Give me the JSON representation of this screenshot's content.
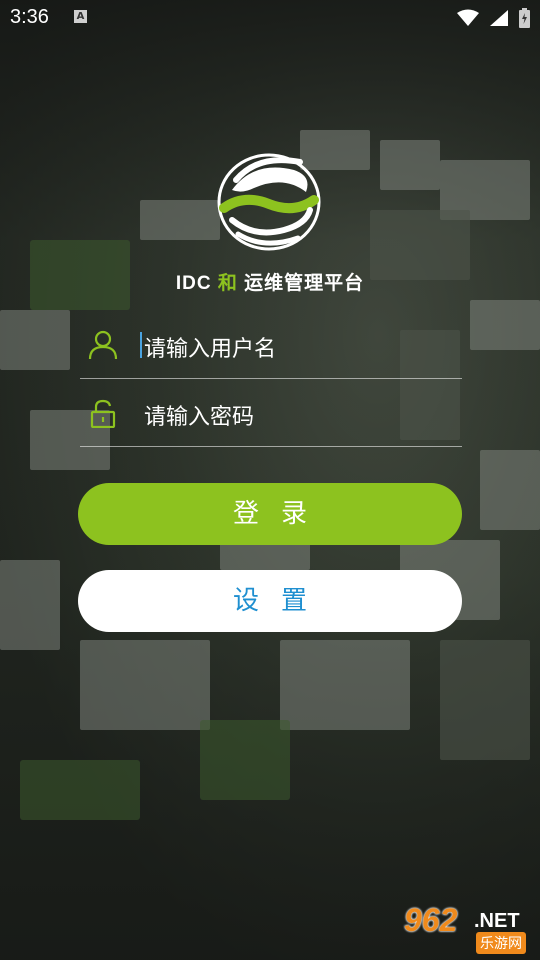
{
  "status_bar": {
    "time": "3:36",
    "notification_letter": "A"
  },
  "brand": {
    "prefix": "IDC",
    "he": "和",
    "suffix": "运维管理平台"
  },
  "login_form": {
    "username_placeholder": "请输入用户名",
    "password_placeholder": "请输入密码",
    "login_label": "登录",
    "settings_label": "设置"
  },
  "watermark": {
    "number": "962",
    "net": ".NET",
    "sub": "乐游网"
  },
  "colors": {
    "accent_green": "#8dc21f",
    "settings_blue": "#1f8fd0"
  },
  "icons": [
    "signal-icon",
    "wifi-icon",
    "battery-icon",
    "user-icon",
    "lock-icon",
    "china-mobile-logo"
  ]
}
